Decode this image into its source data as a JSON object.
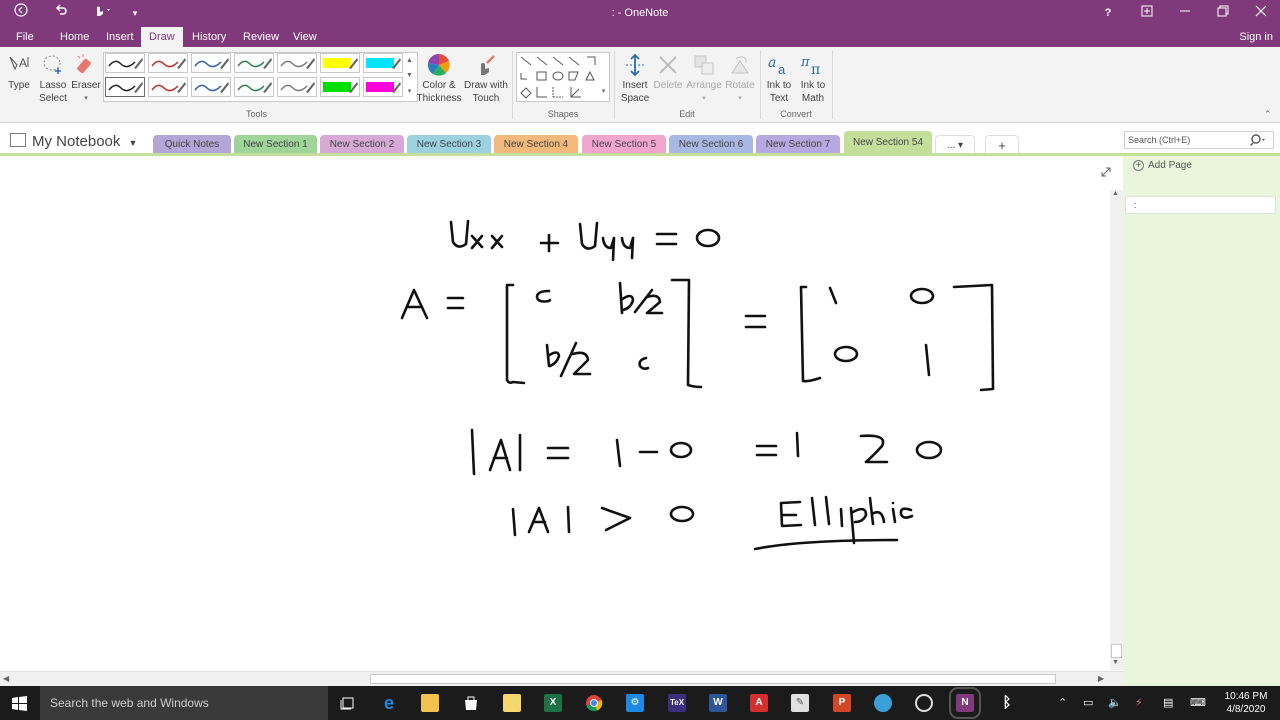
{
  "window": {
    "title": ": - OneNote",
    "help": "?"
  },
  "menu": {
    "tabs": [
      "File",
      "Home",
      "Insert",
      "Draw",
      "History",
      "Review",
      "View"
    ],
    "active": "Draw",
    "sign_in": "Sign in"
  },
  "ribbon": {
    "type": "Type",
    "lasso": "Lasso Select",
    "lasso_l1": "Lasso",
    "lasso_l2": "Select",
    "eraser": "Eraser",
    "color_l1": "Color &",
    "color_l2": "Thickness",
    "draw_l1": "Draw with",
    "draw_l2": "Touch",
    "insert_l1": "Insert",
    "insert_l2": "Space",
    "delete": "Delete",
    "arrange": "Arrange",
    "rotate": "Rotate",
    "ink_text_l1": "Ink to",
    "ink_text_l2": "Text",
    "ink_math_l1": "Ink to",
    "ink_math_l2": "Math",
    "groups": {
      "tools": "Tools",
      "shapes": "Shapes",
      "edit": "Edit",
      "convert": "Convert"
    },
    "pens_row1": [
      "#222222",
      "#c0282d",
      "#2b5f9e",
      "#2e7d46",
      "#7a7a7a",
      "#ffff00",
      "#00e5ff"
    ],
    "pens_row2": [
      "#222222",
      "#c0282d",
      "#2b5f9e",
      "#2e7d46",
      "#7a7a7a",
      "#00e000",
      "#ff00dd"
    ]
  },
  "notebook": {
    "name": "My Notebook",
    "sections": [
      {
        "label": "Quick Notes",
        "color": "#b5a6d8"
      },
      {
        "label": "New Section 1",
        "color": "#9fd49a"
      },
      {
        "label": "New Section 2",
        "color": "#d6a9d6"
      },
      {
        "label": "New Section 3",
        "color": "#9cd1df"
      },
      {
        "label": "New Section 4",
        "color": "#f2b87c"
      },
      {
        "label": "New Section 5",
        "color": "#f2a6cf"
      },
      {
        "label": "New Section 6",
        "color": "#a9b8e3"
      },
      {
        "label": "New Section 7",
        "color": "#b8a8e0"
      },
      {
        "label": "New Section 54",
        "color": "#c4df9b"
      }
    ],
    "more": "...",
    "add": "+",
    "search_placeholder": "Search (Ctrl+E)"
  },
  "pages": {
    "add_page": "Add Page",
    "entry": ":"
  },
  "taskbar": {
    "search": "Search the web and Windows",
    "time": "10:46 PM",
    "date": "4/8/2020"
  },
  "colors": {
    "accent": "#80397b",
    "section_active": "#c4df9b",
    "ink": "#111111"
  }
}
